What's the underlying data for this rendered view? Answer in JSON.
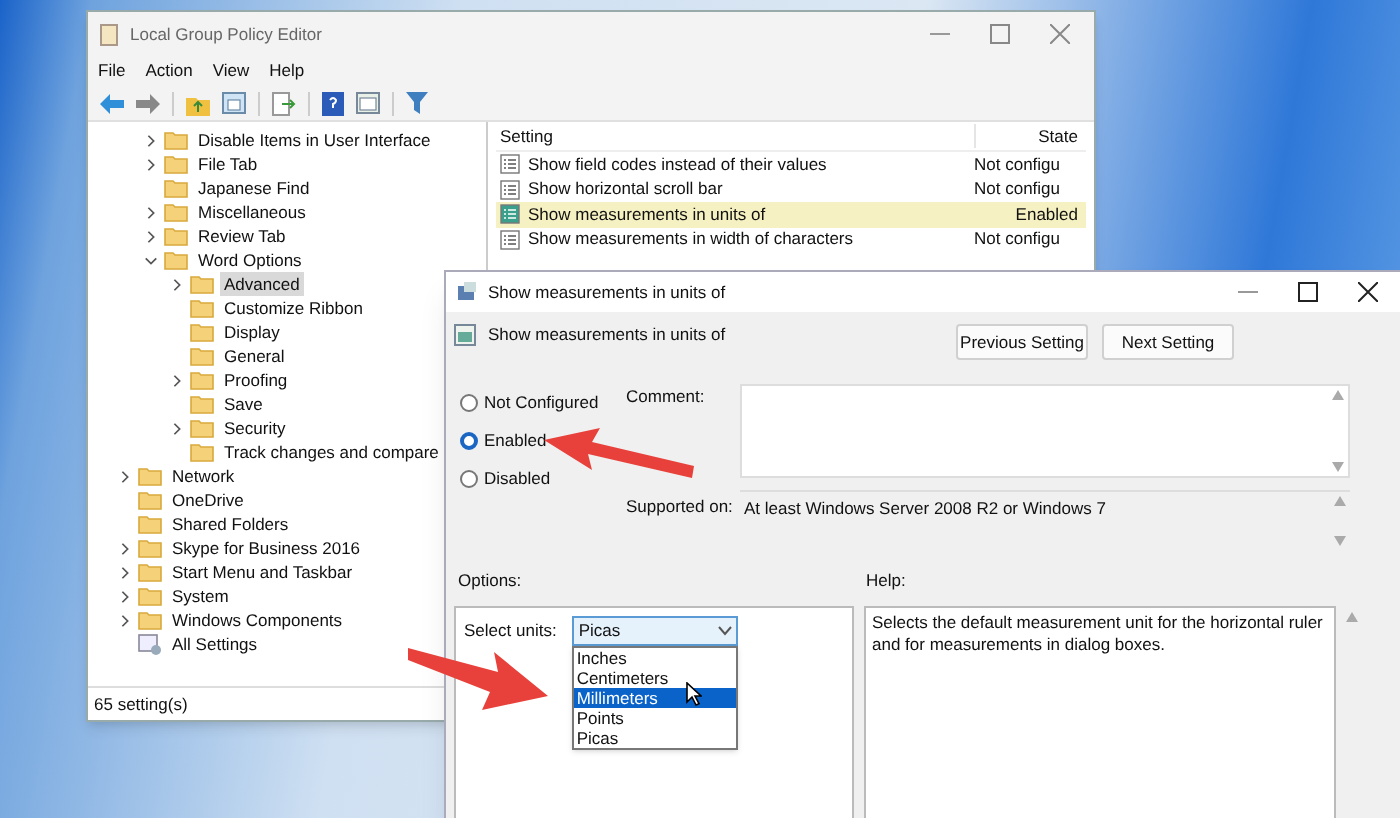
{
  "main_window": {
    "title": "Local Group Policy Editor",
    "menu": [
      "File",
      "Action",
      "View",
      "Help"
    ],
    "tree": [
      {
        "children": [
          {
            "label": "Disable Items in User Interface",
            "kind": "folder",
            "expanded": false,
            "selected": false
          },
          {
            "label": "File Tab",
            "kind": "folder",
            "expanded": false,
            "selected": false
          },
          {
            "label": "Japanese Find",
            "kind": "folder",
            "selected": false
          },
          {
            "label": "Miscellaneous",
            "kind": "folder",
            "expanded": false,
            "selected": false
          },
          {
            "label": "Review Tab",
            "kind": "folder",
            "expanded": false,
            "selected": false
          },
          {
            "label": "Word Options",
            "kind": "folder",
            "expanded": true,
            "selected": false,
            "children": [
              {
                "label": "Advanced",
                "kind": "folder",
                "expanded": false,
                "selected": true
              },
              {
                "label": "Customize Ribbon",
                "kind": "folder",
                "selected": false
              },
              {
                "label": "Display",
                "kind": "folder",
                "selected": false
              },
              {
                "label": "General",
                "kind": "folder",
                "selected": false
              },
              {
                "label": "Proofing",
                "kind": "folder",
                "expanded": false,
                "selected": false
              },
              {
                "label": "Save",
                "kind": "folder",
                "selected": false
              },
              {
                "label": "Security",
                "kind": "folder",
                "expanded": false,
                "selected": false
              },
              {
                "label": "Track changes and compare",
                "kind": "folder",
                "selected": false
              }
            ]
          }
        ]
      },
      {
        "label": "Network",
        "kind": "folder",
        "expanded": false,
        "selected": false
      },
      {
        "label": "OneDrive",
        "kind": "folder",
        "selected": false
      },
      {
        "label": "Shared Folders",
        "kind": "folder",
        "selected": false
      },
      {
        "label": "Skype for Business 2016",
        "kind": "folder",
        "expanded": false,
        "selected": false
      },
      {
        "label": "Start Menu and Taskbar",
        "kind": "folder",
        "expanded": false,
        "selected": false
      },
      {
        "label": "System",
        "kind": "folder",
        "expanded": false,
        "selected": false
      },
      {
        "label": "Windows Components",
        "kind": "folder",
        "expanded": false,
        "selected": false
      },
      {
        "label": "All Settings",
        "kind": "settings",
        "selected": false
      }
    ],
    "list": {
      "columns": [
        "Setting",
        "State"
      ],
      "rows": [
        {
          "setting": "Show field codes instead of their values",
          "state": "Not configu",
          "selected": false
        },
        {
          "setting": "Show horizontal scroll bar",
          "state": "Not configu",
          "selected": false
        },
        {
          "setting": "Show measurements in units of",
          "state": "Enabled",
          "selected": true
        },
        {
          "setting": "Show measurements in width of characters",
          "state": "Not configu",
          "selected": false
        }
      ]
    },
    "status_bar": "65 setting(s)"
  },
  "dialog": {
    "title": "Show measurements in units of",
    "setting_name": "Show measurements in units of",
    "buttons": [
      "Previous Setting",
      "Next Setting"
    ],
    "radios": [
      {
        "label": "Not Configured",
        "selected": false
      },
      {
        "label": "Enabled",
        "selected": true
      },
      {
        "label": "Disabled",
        "selected": false
      }
    ],
    "comment_label": "Comment:",
    "supported_label": "Supported on:",
    "supported_value": "At least Windows Server 2008 R2 or Windows 7",
    "options_label": "Options:",
    "help_label": "Help:",
    "select": {
      "label": "Select units:",
      "value": "Picas",
      "expanded": true,
      "choices": [
        {
          "label": "Inches",
          "highlighted": false
        },
        {
          "label": "Centimeters",
          "highlighted": false
        },
        {
          "label": "Millimeters",
          "highlighted": true
        },
        {
          "label": "Points",
          "highlighted": false
        },
        {
          "label": "Picas",
          "highlighted": false
        }
      ]
    },
    "help_text": "Selects the default measurement unit for the horizontal ruler and for measurements in dialog boxes."
  }
}
